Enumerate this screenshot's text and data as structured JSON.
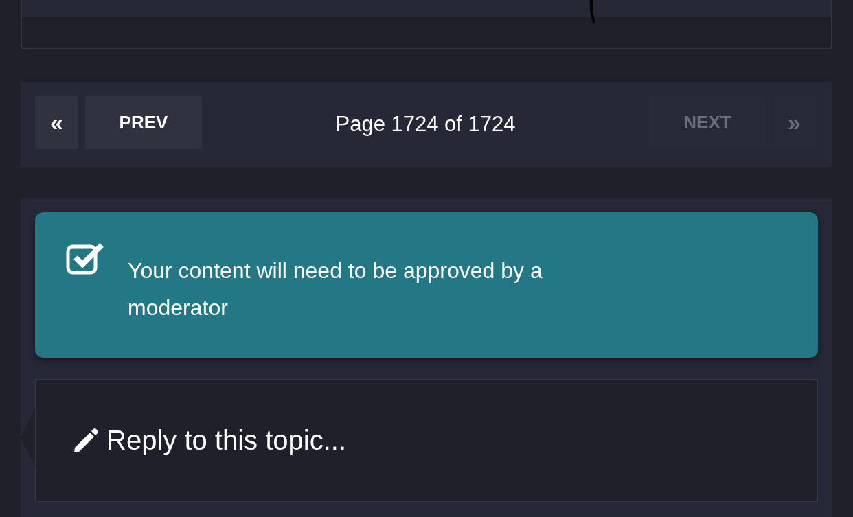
{
  "pagination": {
    "first": {
      "label": "«",
      "disabled": false
    },
    "prev": {
      "label": "PREV",
      "disabled": false
    },
    "status": "Page 1724 of 1724",
    "next": {
      "label": "NEXT",
      "disabled": true
    },
    "last": {
      "label": "»",
      "disabled": true
    }
  },
  "notice": {
    "text": "Your content will need to be approved by a moderator"
  },
  "reply": {
    "prompt": "Reply to this topic..."
  }
}
